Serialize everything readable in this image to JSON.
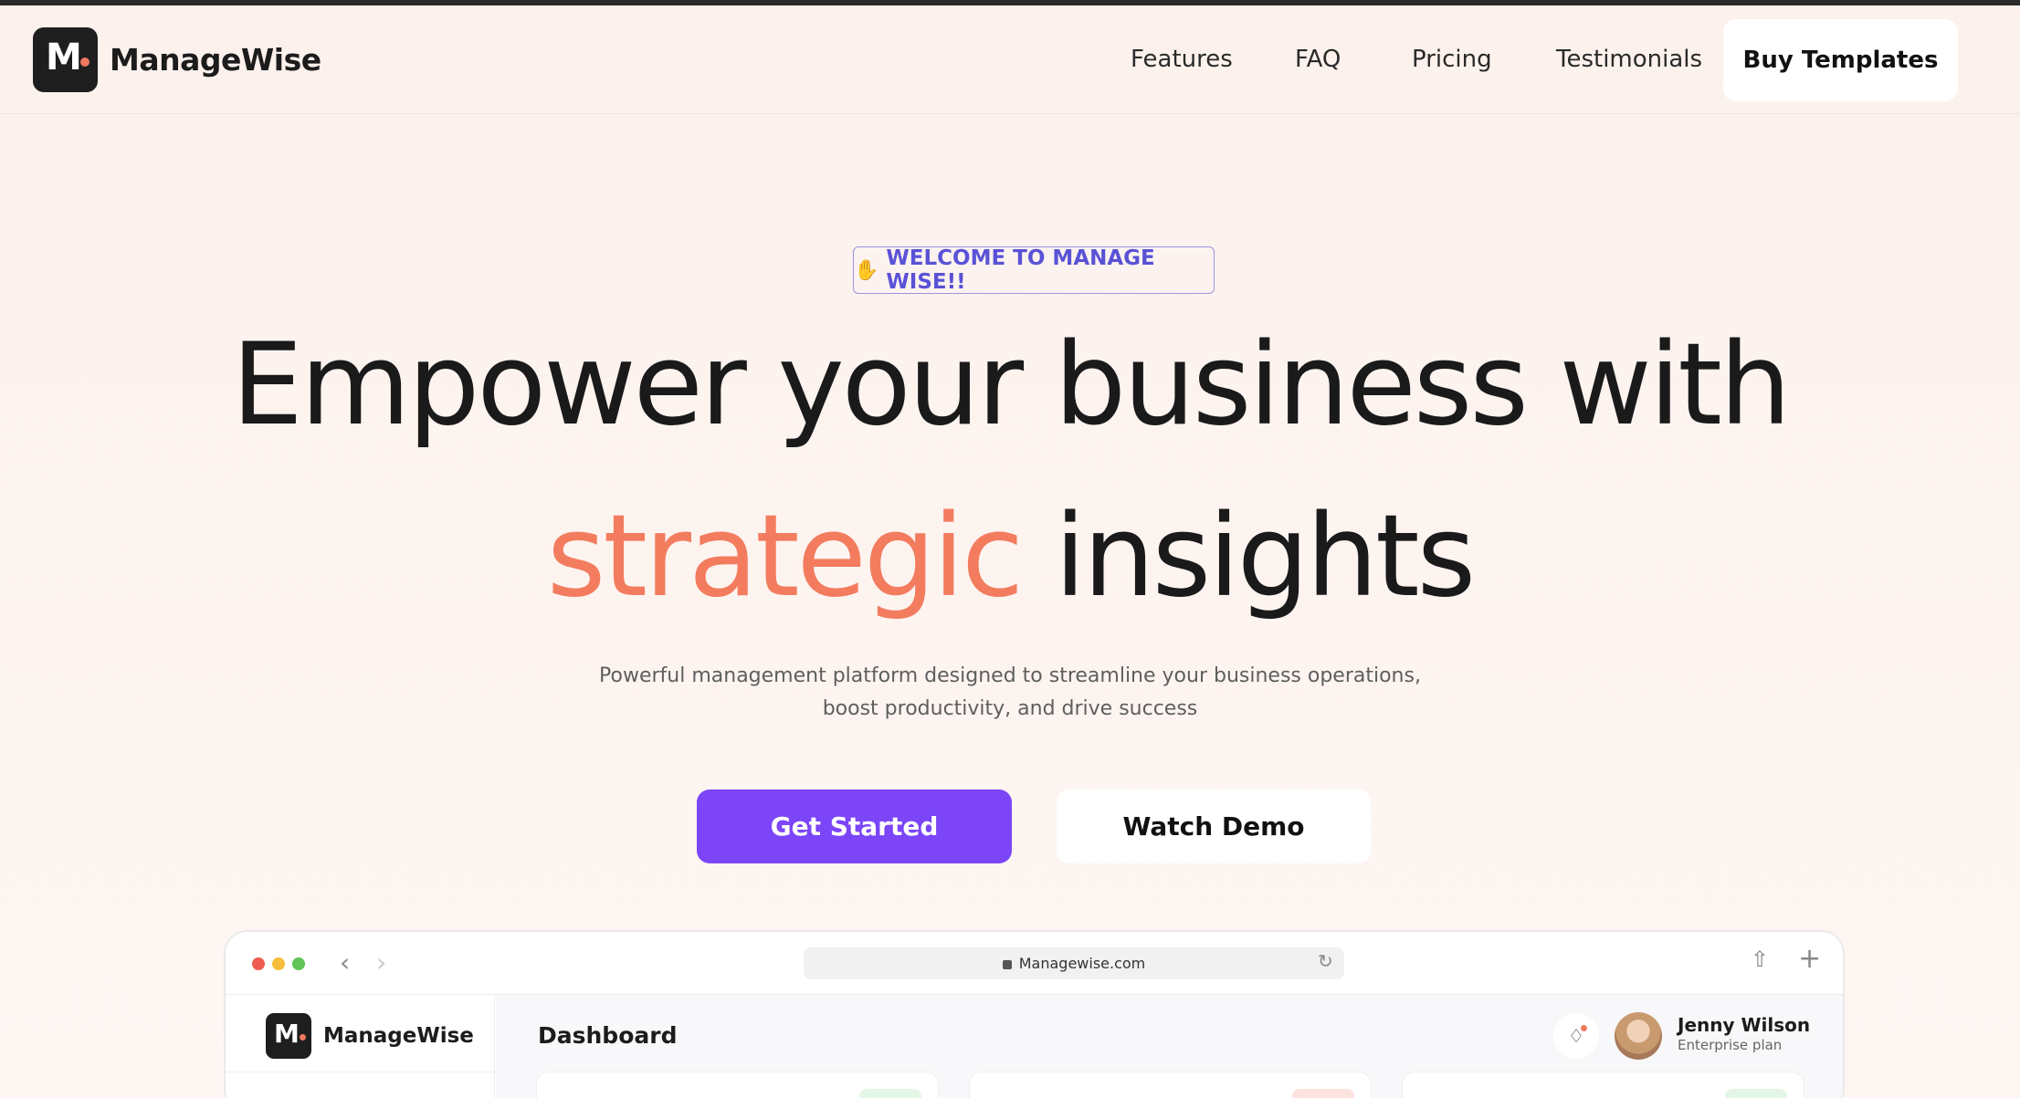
{
  "nav": {
    "logo_letter": "M",
    "brand": "ManageWise",
    "links": [
      "Features",
      "FAQ",
      "Pricing",
      "Testimonials"
    ],
    "cta": "Buy Templates"
  },
  "hero": {
    "badge": "WELCOME TO MANAGE WISE!!",
    "badge_icon": "waving-hand-icon",
    "headline_line1": "Empower your business with",
    "headline_accent": "strategic",
    "headline_rest": "insights",
    "subtitle_line1": "Powerful management platform designed to streamline your business operations,",
    "subtitle_line2": "boost productivity, and drive success",
    "primary_button": "Get Started",
    "secondary_button": "Watch Demo"
  },
  "browser": {
    "url": "Managewise.com",
    "app": {
      "logo_letter": "M",
      "brand": "ManageWise",
      "page_title": "Dashboard",
      "user_name": "Jenny Wilson",
      "user_plan": "Enterprise plan"
    }
  },
  "colors": {
    "accent": "#f37c5f",
    "primary": "#7c45f8",
    "badge": "#5a52d6",
    "background": "#fcf1ec"
  }
}
